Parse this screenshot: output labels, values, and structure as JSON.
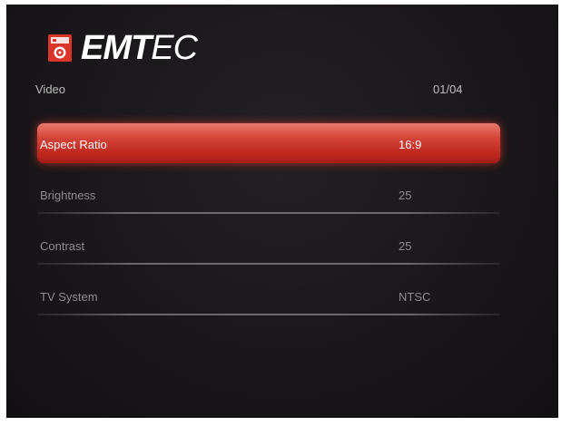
{
  "brand": {
    "name_bold": "EMT",
    "name_light": "EC",
    "logo_icon": "emtec-speaker-icon"
  },
  "header": {
    "title": "Video",
    "page_indicator": "01/04"
  },
  "settings": [
    {
      "label": "Aspect Ratio",
      "value": "16:9",
      "selected": true
    },
    {
      "label": "Brightness",
      "value": "25",
      "selected": false
    },
    {
      "label": "Contrast",
      "value": "25",
      "selected": false
    },
    {
      "label": "TV System",
      "value": "NTSC",
      "selected": false
    }
  ],
  "colors": {
    "selection": "#d6463a",
    "background": "#1a171a",
    "text_inactive": "#8d8d8d",
    "text_active": "#ffffff"
  }
}
